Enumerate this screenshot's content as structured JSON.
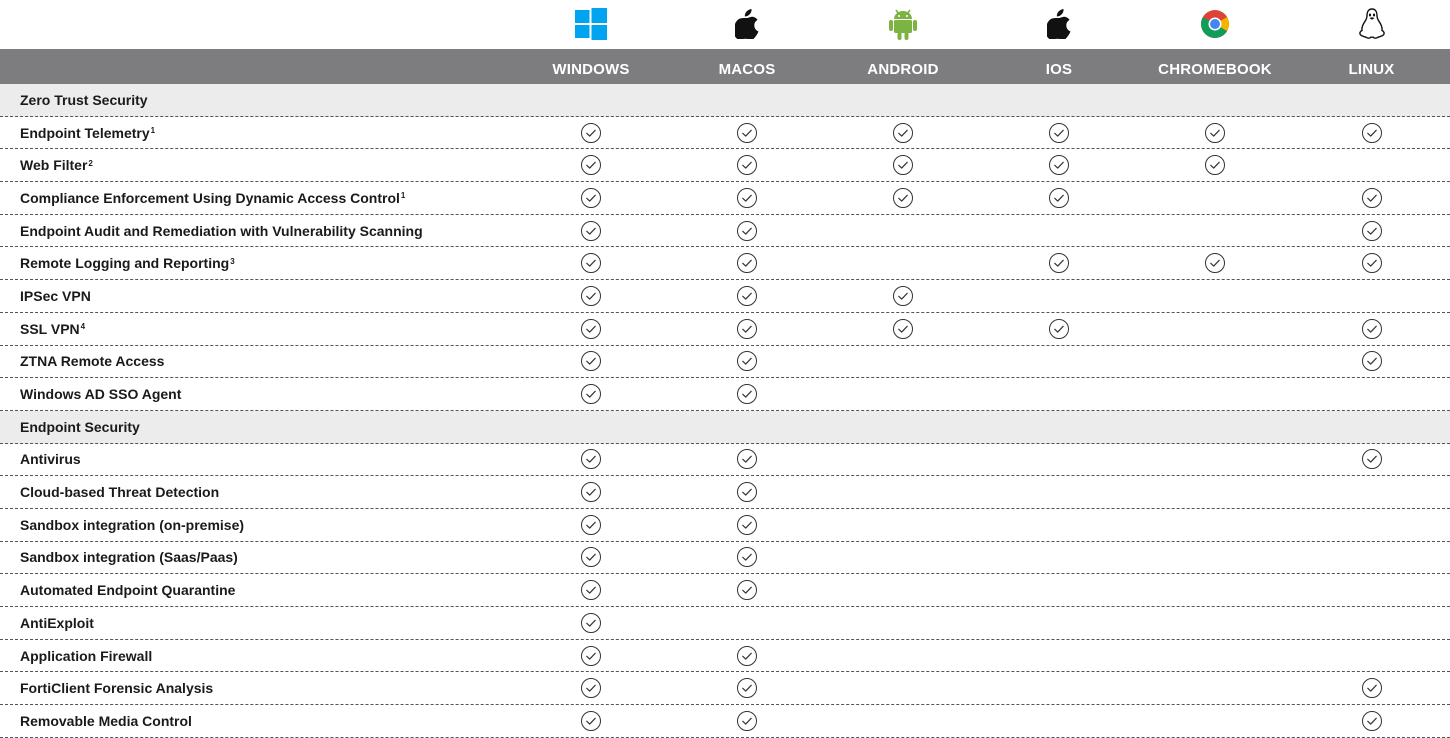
{
  "platforms": [
    {
      "name": "WINDOWS",
      "icon": "windows-icon",
      "color": "#00a4ef"
    },
    {
      "name": "MACOS",
      "icon": "apple-icon",
      "color": "#111111"
    },
    {
      "name": "ANDROID",
      "icon": "android-icon",
      "color": "#7cb342"
    },
    {
      "name": "IOS",
      "icon": "apple-icon",
      "color": "#111111"
    },
    {
      "name": "CHROMEBOOK",
      "icon": "chrome-icon",
      "color": "#4285f4"
    },
    {
      "name": "LINUX",
      "icon": "linux-tux-icon",
      "color": "#111111"
    }
  ],
  "rows": [
    {
      "type": "section",
      "label": "Zero Trust Security",
      "sup": "",
      "checks": [
        0,
        0,
        0,
        0,
        0,
        0
      ]
    },
    {
      "type": "feature",
      "label": "Endpoint Telemetry",
      "sup": "1",
      "checks": [
        1,
        1,
        1,
        1,
        1,
        1
      ]
    },
    {
      "type": "feature",
      "label": "Web Filter",
      "sup": "2",
      "checks": [
        1,
        1,
        1,
        1,
        1,
        0
      ]
    },
    {
      "type": "feature",
      "label": "Compliance Enforcement Using Dynamic Access Control",
      "sup": "1",
      "checks": [
        1,
        1,
        1,
        1,
        0,
        1
      ]
    },
    {
      "type": "feature",
      "label": "Endpoint Audit and Remediation with Vulnerability Scanning",
      "sup": "",
      "checks": [
        1,
        1,
        0,
        0,
        0,
        1
      ]
    },
    {
      "type": "feature",
      "label": "Remote Logging and Reporting",
      "sup": "3",
      "checks": [
        1,
        1,
        0,
        1,
        1,
        1
      ]
    },
    {
      "type": "feature",
      "label": "IPSec VPN",
      "sup": "",
      "checks": [
        1,
        1,
        1,
        0,
        0,
        0
      ]
    },
    {
      "type": "feature",
      "label": "SSL VPN",
      "sup": "4",
      "checks": [
        1,
        1,
        1,
        1,
        0,
        1
      ]
    },
    {
      "type": "feature",
      "label": "ZTNA Remote Access",
      "sup": "",
      "checks": [
        1,
        1,
        0,
        0,
        0,
        1
      ]
    },
    {
      "type": "feature",
      "label": "Windows AD SSO Agent",
      "sup": "",
      "checks": [
        1,
        1,
        0,
        0,
        0,
        0
      ]
    },
    {
      "type": "section",
      "label": "Endpoint Security",
      "sup": "",
      "checks": [
        0,
        0,
        0,
        0,
        0,
        0
      ]
    },
    {
      "type": "feature",
      "label": "Antivirus",
      "sup": "",
      "checks": [
        1,
        1,
        0,
        0,
        0,
        1
      ]
    },
    {
      "type": "feature",
      "label": "Cloud-based Threat Detection",
      "sup": "",
      "checks": [
        1,
        1,
        0,
        0,
        0,
        0
      ]
    },
    {
      "type": "feature",
      "label": "Sandbox integration (on-premise)",
      "sup": "",
      "checks": [
        1,
        1,
        0,
        0,
        0,
        0
      ]
    },
    {
      "type": "feature",
      "label": "Sandbox integration (Saas/Paas)",
      "sup": "",
      "checks": [
        1,
        1,
        0,
        0,
        0,
        0
      ]
    },
    {
      "type": "feature",
      "label": "Automated Endpoint Quarantine",
      "sup": "",
      "checks": [
        1,
        1,
        0,
        0,
        0,
        0
      ]
    },
    {
      "type": "feature",
      "label": "AntiExploit",
      "sup": "",
      "checks": [
        1,
        0,
        0,
        0,
        0,
        0
      ]
    },
    {
      "type": "feature",
      "label": "Application Firewall",
      "sup": "",
      "checks": [
        1,
        1,
        0,
        0,
        0,
        0
      ]
    },
    {
      "type": "feature",
      "label": "FortiClient Forensic Analysis",
      "sup": "",
      "checks": [
        1,
        1,
        0,
        0,
        0,
        1
      ]
    },
    {
      "type": "feature",
      "label": "Removable Media Control",
      "sup": "",
      "checks": [
        1,
        1,
        0,
        0,
        0,
        1
      ]
    }
  ],
  "style": {
    "header_bg": "#7d7d7f",
    "section_bg": "#ececec",
    "check_color": "#333333"
  }
}
